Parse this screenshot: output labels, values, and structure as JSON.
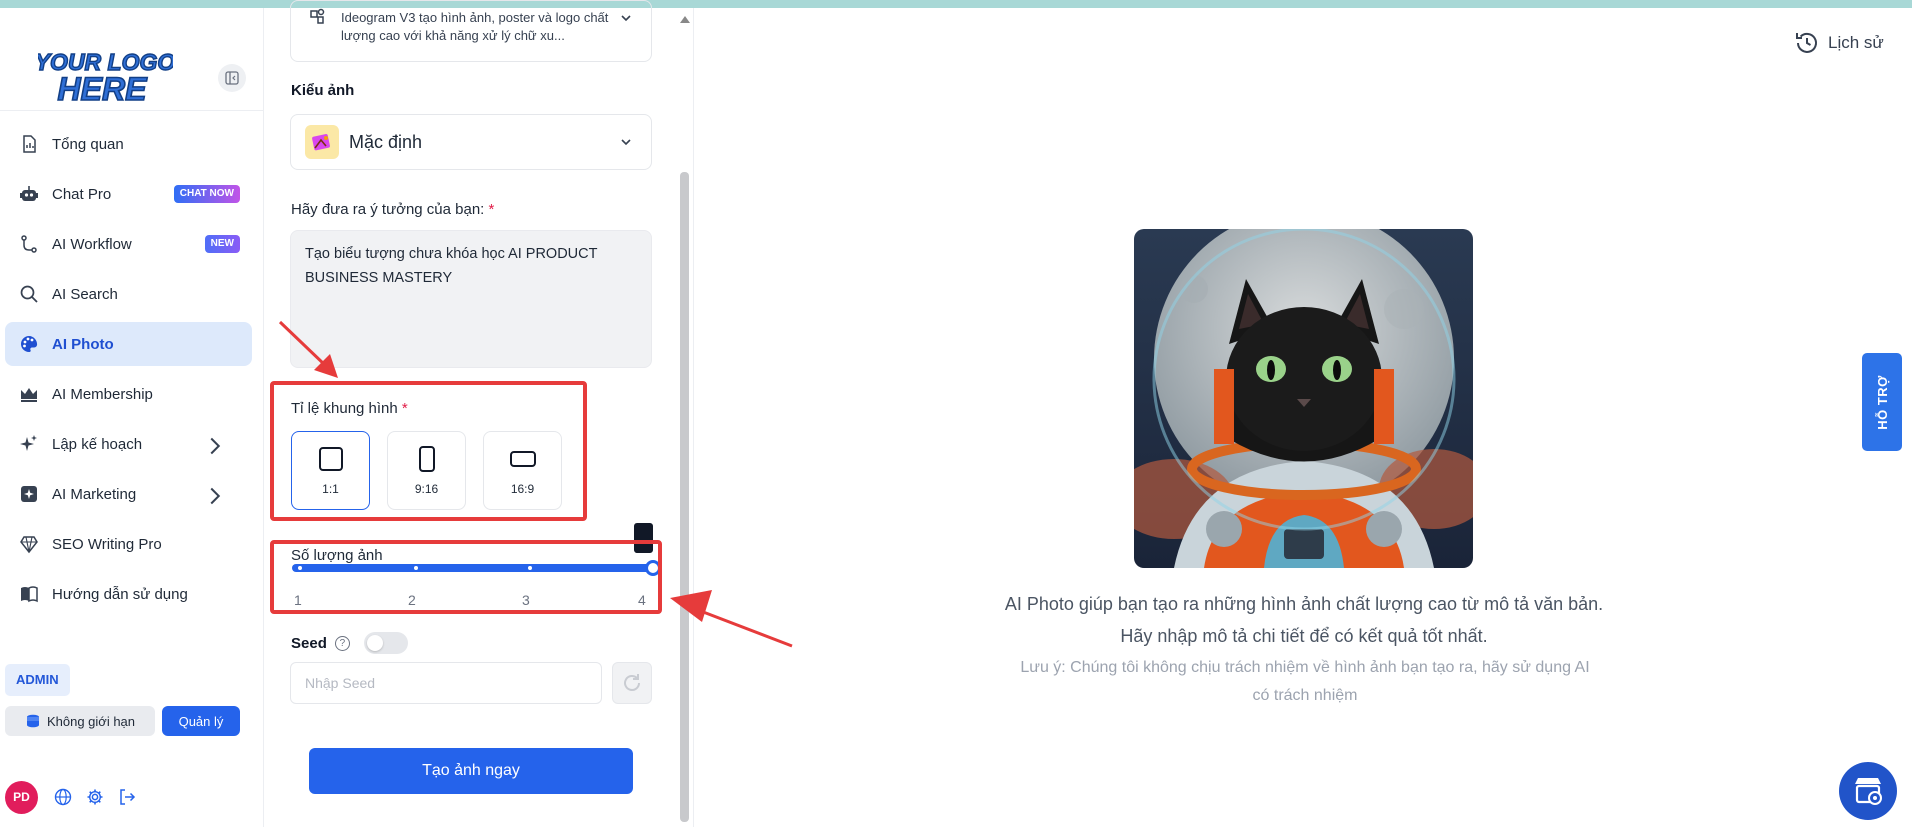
{
  "sidebar": {
    "logo_text": [
      "YOUR LOGO",
      "HERE"
    ],
    "items": [
      {
        "label": "Tổng quan",
        "icon": "chart-icon"
      },
      {
        "label": "Chat Pro",
        "icon": "robot-icon",
        "badge": "CHAT NOW"
      },
      {
        "label": "AI Workflow",
        "icon": "workflow-icon",
        "badge": "NEW"
      },
      {
        "label": "AI Search",
        "icon": "search-icon"
      },
      {
        "label": "AI Photo",
        "icon": "palette-icon",
        "active": true
      },
      {
        "label": "AI Membership",
        "icon": "crown-icon"
      },
      {
        "label": "Lập kế hoạch",
        "icon": "sparkle-icon",
        "has_submenu": true
      },
      {
        "label": "AI Marketing",
        "icon": "marketing-icon",
        "has_submenu": true
      },
      {
        "label": "SEO Writing Pro",
        "icon": "diamond-icon"
      },
      {
        "label": "Hướng dẫn sử dụng",
        "icon": "book-icon"
      }
    ],
    "admin_label": "ADMIN",
    "unlimited_label": "Không giới hạn",
    "manage_label": "Quản lý",
    "avatar_initials": "PD"
  },
  "form": {
    "model_description": "Ideogram V3 tạo hình ảnh, poster và logo chất lượng cao với khả năng xử lý chữ xu...",
    "style_label": "Kiểu ảnh",
    "style_value": "Mặc định",
    "prompt_label": "Hãy đưa ra ý tưởng của bạn:",
    "prompt_value": "Tạo biểu tượng chưa khóa học AI PRODUCT BUSINESS MASTERY",
    "ratio_label": "Tỉ lệ khung hình",
    "ratios": [
      {
        "label": "1:1",
        "selected": true
      },
      {
        "label": "9:16",
        "selected": false
      },
      {
        "label": "16:9",
        "selected": false
      }
    ],
    "count_label": "Số lượng ảnh",
    "count_ticks": [
      "1",
      "2",
      "3",
      "4"
    ],
    "count_value": 4,
    "seed_label": "Seed",
    "seed_placeholder": "Nhập Seed",
    "create_label": "Tạo ảnh ngay"
  },
  "main": {
    "history_label": "Lịch sử",
    "description": "AI Photo giúp bạn tạo ra những hình ảnh chất lượng cao từ mô tả văn bản. Hãy nhập mô tả chi tiết để có kết quả tốt nhất.",
    "note": "Lưu ý: Chúng tôi không chịu trách nhiệm về hình ảnh bạn tạo ra, hãy sử dụng AI có trách nhiệm",
    "support_label": "HỖ TRỢ"
  },
  "colors": {
    "primary": "#2563eb",
    "active_bg": "#dde9fb",
    "annotation": "#e63b3b"
  }
}
